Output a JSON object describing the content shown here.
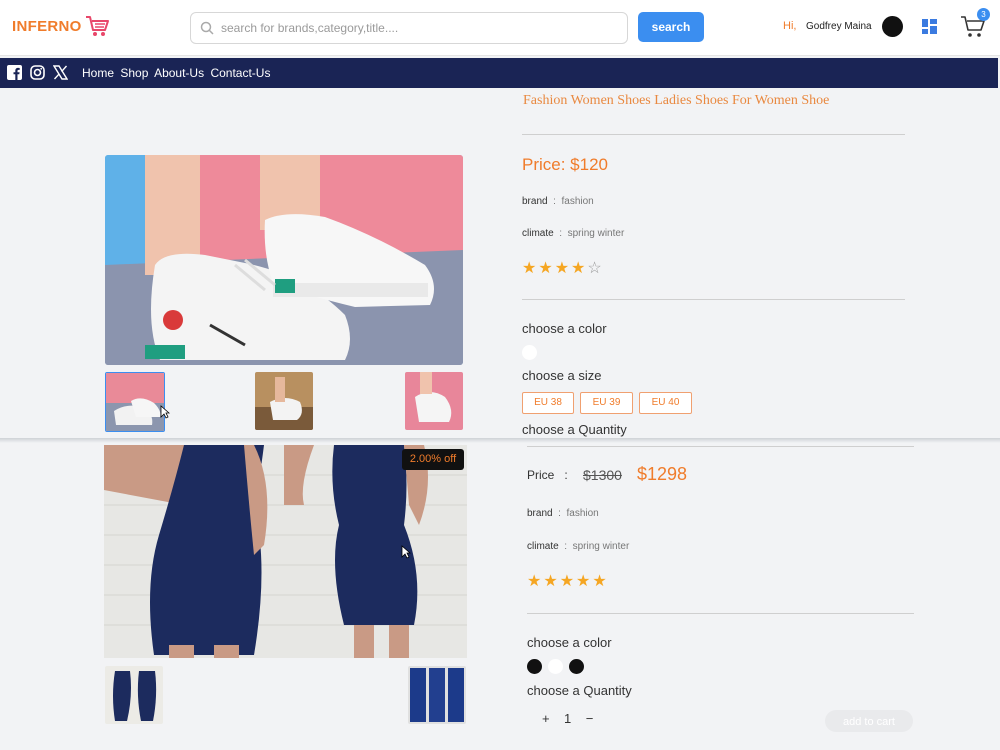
{
  "header": {
    "logo_text": "INFERNO",
    "search_placeholder": "search for brands,category,title....",
    "search_button": "search",
    "greeting": "Hi,",
    "user_name": "Godfrey Maina",
    "cart_count": "3",
    "accent_color": "#f07c2b",
    "primary_color": "#3b8ef0"
  },
  "nav": {
    "links": [
      "Home",
      "Shop",
      "About-Us",
      "Contact-Us"
    ],
    "social_icons": [
      "facebook-icon",
      "instagram-icon",
      "x-icon"
    ],
    "bg_color": "#1a2455"
  },
  "product1": {
    "title": "Fashion Women Shoes Ladies Shoes For Women Shoe",
    "price": "Price: $120",
    "brand_label": "brand",
    "brand_value": "fashion",
    "climate_label": "climate",
    "climate_value": "spring  winter",
    "rating": 4,
    "rating_max": 5,
    "stars_full": "★★★★",
    "stars_empty": "☆",
    "choose_color": "choose a color",
    "colors": [
      "#ffffff"
    ],
    "choose_size": "choose a size",
    "sizes": [
      "EU 38",
      "EU 39",
      "EU 40"
    ],
    "choose_quantity": "choose a Quantity"
  },
  "product2": {
    "discount_badge": "2.00% off",
    "price_label": "Price",
    "price_sep": ":",
    "old_price": "$1300",
    "new_price": "$1298",
    "brand_label": "brand",
    "brand_value": "fashion",
    "climate_label": "climate",
    "climate_value": "spring  winter",
    "rating": 5,
    "rating_max": 5,
    "stars_full": "★★★★★",
    "choose_color": "choose a color",
    "colors": [
      "#111111",
      "#ffffff",
      "#111111"
    ],
    "choose_quantity": "choose a Quantity",
    "qty_plus": "+",
    "qty_value": "1",
    "qty_minus": "−",
    "add_to_cart": "add to cart"
  }
}
